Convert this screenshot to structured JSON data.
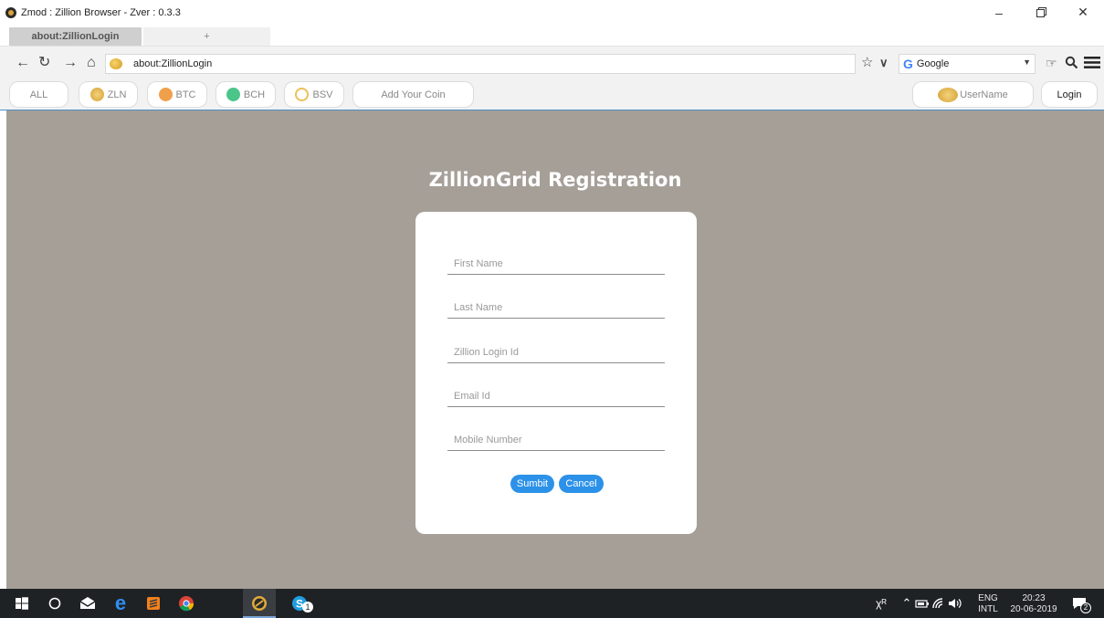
{
  "window": {
    "title": "Zmod : Zillion Browser - Zver : 0.3.3",
    "minimize_icon": "minimize-icon",
    "restore_icon": "restore-icon",
    "close_icon": "close-icon"
  },
  "tabs": [
    {
      "label": "about:ZillionLogin"
    },
    {
      "label": "+"
    }
  ],
  "navbar": {
    "url": "about:ZillionLogin",
    "search_engine": "Google",
    "icons": [
      "back-arrow-icon",
      "reload-icon",
      "forward-arrow-icon",
      "home-icon",
      "star-icon",
      "chevron-down-icon",
      "hand-icon",
      "zoom-icon",
      "menu-icon"
    ]
  },
  "coinbar": {
    "all": "ALL",
    "zln": "ZLN",
    "btc": "BTC",
    "bch": "BCH",
    "bsv": "BSV",
    "add_coin": "Add Your Coin",
    "username": "UserName",
    "login": "Login"
  },
  "form": {
    "title": "ZillionGrid Registration",
    "first_name_placeholder": "First Name",
    "last_name_placeholder": "Last Name",
    "login_id_placeholder": "Zillion Login Id",
    "email_placeholder": "Email Id",
    "mobile_placeholder": "Mobile Number",
    "submit_label": "Sumbit",
    "cancel_label": "Cancel"
  },
  "taskbar": {
    "skype_badge": "1",
    "language_top": "ENG",
    "language_bottom": "INTL",
    "time": "20:23",
    "date": "20-06-2019",
    "notification_badge": "2"
  },
  "colors": {
    "content_bg": "#a59f98",
    "button_blue": "#2c91e8",
    "taskbar_bg": "#1f2225"
  }
}
